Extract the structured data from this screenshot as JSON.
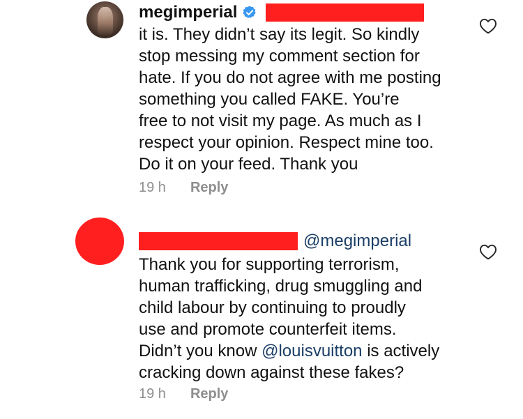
{
  "comments": [
    {
      "username": "megimperial",
      "verified": true,
      "text": "it is. They didn’t say its legit. So kindly\nstop messing my comment section for\nhate. If you do not agree with me posting\nsomething you called FAKE. You’re\nfree to not visit my page. As much as I\nrespect your opinion. Respect mine too.\nDo it on your feed. Thank you",
      "time": "19 h",
      "reply_label": "Reply",
      "like_icon": "heart-outline-icon"
    },
    {
      "mention": "@megimperial",
      "text_before": "Thank you for supporting terrorism,\nhuman trafficking, drug smuggling and\nchild labour by continuing to proudly\nuse and promote counterfeit items.\nDidn’t you know ",
      "text_mention": "@louisvuitton",
      "text_after": " is actively\ncracking down against these fakes?",
      "time": "19 h",
      "reply_label": "Reply",
      "like_icon": "heart-outline-icon"
    }
  ],
  "colors": {
    "redaction": "#ff1f1f",
    "verified_badge": "#3897f0",
    "mention": "#1a3e66",
    "meta": "#8e8e8e"
  }
}
